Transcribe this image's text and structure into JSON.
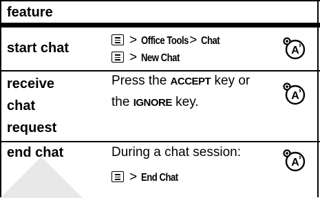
{
  "header": {
    "label": "feature"
  },
  "rows": [
    {
      "feature": "start chat",
      "lines": [
        {
          "items": [
            "Office Tools",
            "Chat"
          ]
        },
        {
          "items": [
            "New Chat"
          ]
        }
      ]
    },
    {
      "feature_lines": [
        "receive",
        "chat",
        "request"
      ],
      "text": {
        "l1_pre": "Press the ",
        "l1_key": "ACCEPT",
        "l1_post": " key or",
        "l2_pre": "the ",
        "l2_key": "IGNORE",
        "l2_post": " key."
      }
    },
    {
      "feature": "end chat",
      "text": "During a chat session:",
      "items": [
        "End Chat"
      ]
    }
  ],
  "symbols": {
    "gt": ">"
  },
  "icons": {
    "menu_key": "menu-key-icon",
    "voice": "voice-command-icon"
  },
  "colors": {
    "rule": "#000000",
    "watermark": "#e8e8e8"
  }
}
